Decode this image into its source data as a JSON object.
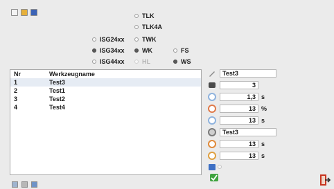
{
  "toolbar": {
    "buttons": [
      "new-icon",
      "open-icon",
      "save-icon"
    ]
  },
  "radios": {
    "tlk": {
      "label": "TLK",
      "selected": false
    },
    "tlk4a": {
      "label": "TLK4A",
      "selected": false
    },
    "isg24": {
      "label": "ISG24xx",
      "selected": false
    },
    "twk": {
      "label": "TWK",
      "selected": false
    },
    "isg34": {
      "label": "ISG34xx",
      "selected": true
    },
    "wk": {
      "label": "WK",
      "selected": true
    },
    "fs": {
      "label": "FS",
      "selected": false
    },
    "isg44": {
      "label": "ISG44xx",
      "selected": false
    },
    "hl": {
      "label": "HL",
      "selected": false,
      "disabled": true
    },
    "ws": {
      "label": "WS",
      "selected": true
    }
  },
  "list": {
    "headers": {
      "nr": "Nr",
      "name": "Werkzeugname"
    },
    "rows": [
      {
        "nr": "1",
        "name": "Test3"
      },
      {
        "nr": "2",
        "name": "Test1"
      },
      {
        "nr": "3",
        "name": "Test2"
      },
      {
        "nr": "4",
        "name": "Test4"
      }
    ]
  },
  "props": {
    "name": "Test3",
    "count": "3",
    "time1": "1,3",
    "percent": "13",
    "time2": "13",
    "name2": "Test3",
    "time3": "13",
    "time4": "13",
    "units": {
      "s": "s",
      "pct": "%"
    }
  },
  "colors": {
    "accent": "#2f6fd0",
    "confirm": "#3fa33f",
    "exit": "#c8341f"
  }
}
